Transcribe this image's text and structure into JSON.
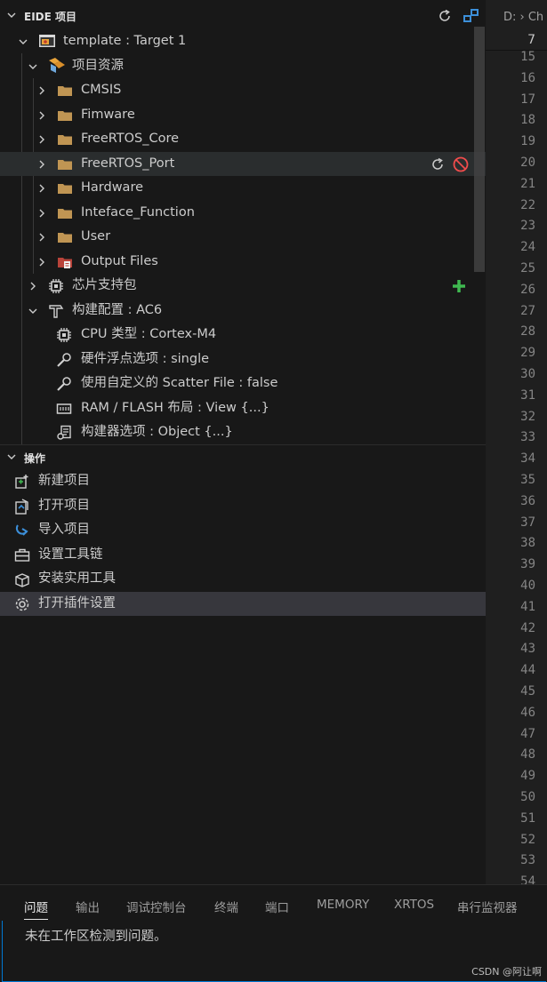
{
  "eide_section": {
    "title": "EIDE 项目"
  },
  "project_tree": {
    "project": "template : Target 1",
    "resources": {
      "label": "项目资源",
      "folders": [
        "CMSIS",
        "Fimware",
        "FreeRTOS_Core",
        "FreeRTOS_Port",
        "Hardware",
        "Inteface_Function",
        "User"
      ],
      "output": "Output Files"
    },
    "chip_package": "芯片支持包",
    "build_config": {
      "label": "构建配置 : AC6",
      "items": [
        "CPU 类型 : Cortex-M4",
        "硬件浮点选项 : single",
        "使用自定义的 Scatter File : false",
        "RAM / FLASH 布局 : View {...}",
        "构建器选项 : Object {...}"
      ]
    }
  },
  "operations_section": {
    "title": "操作",
    "items": [
      "新建项目",
      "打开项目",
      "导入项目",
      "设置工具链",
      "安装实用工具",
      "打开插件设置"
    ]
  },
  "editor": {
    "breadcrumb": "D: › Ch",
    "current_line": "7",
    "line_numbers": [
      "15",
      "16",
      "17",
      "18",
      "19",
      "20",
      "21",
      "22",
      "23",
      "24",
      "25",
      "26",
      "27",
      "28",
      "29",
      "30",
      "31",
      "32",
      "33",
      "34",
      "35",
      "36",
      "37",
      "38",
      "39",
      "40",
      "41",
      "42",
      "43",
      "44",
      "45",
      "46",
      "47",
      "48",
      "49",
      "50",
      "51",
      "52",
      "53",
      "54"
    ]
  },
  "panel": {
    "tabs": [
      "问题",
      "输出",
      "调试控制台",
      "终端",
      "端口",
      "MEMORY",
      "XRTOS",
      "串行监视器"
    ],
    "active_tab": "问题",
    "message": "未在工作区检测到问题。",
    "watermark": "CSDN @阿让啊"
  },
  "colors": {
    "folder": "#c09553",
    "add_green": "#3fb950",
    "stop_red": "#f14c4c",
    "focus_border": "#0078d4"
  }
}
